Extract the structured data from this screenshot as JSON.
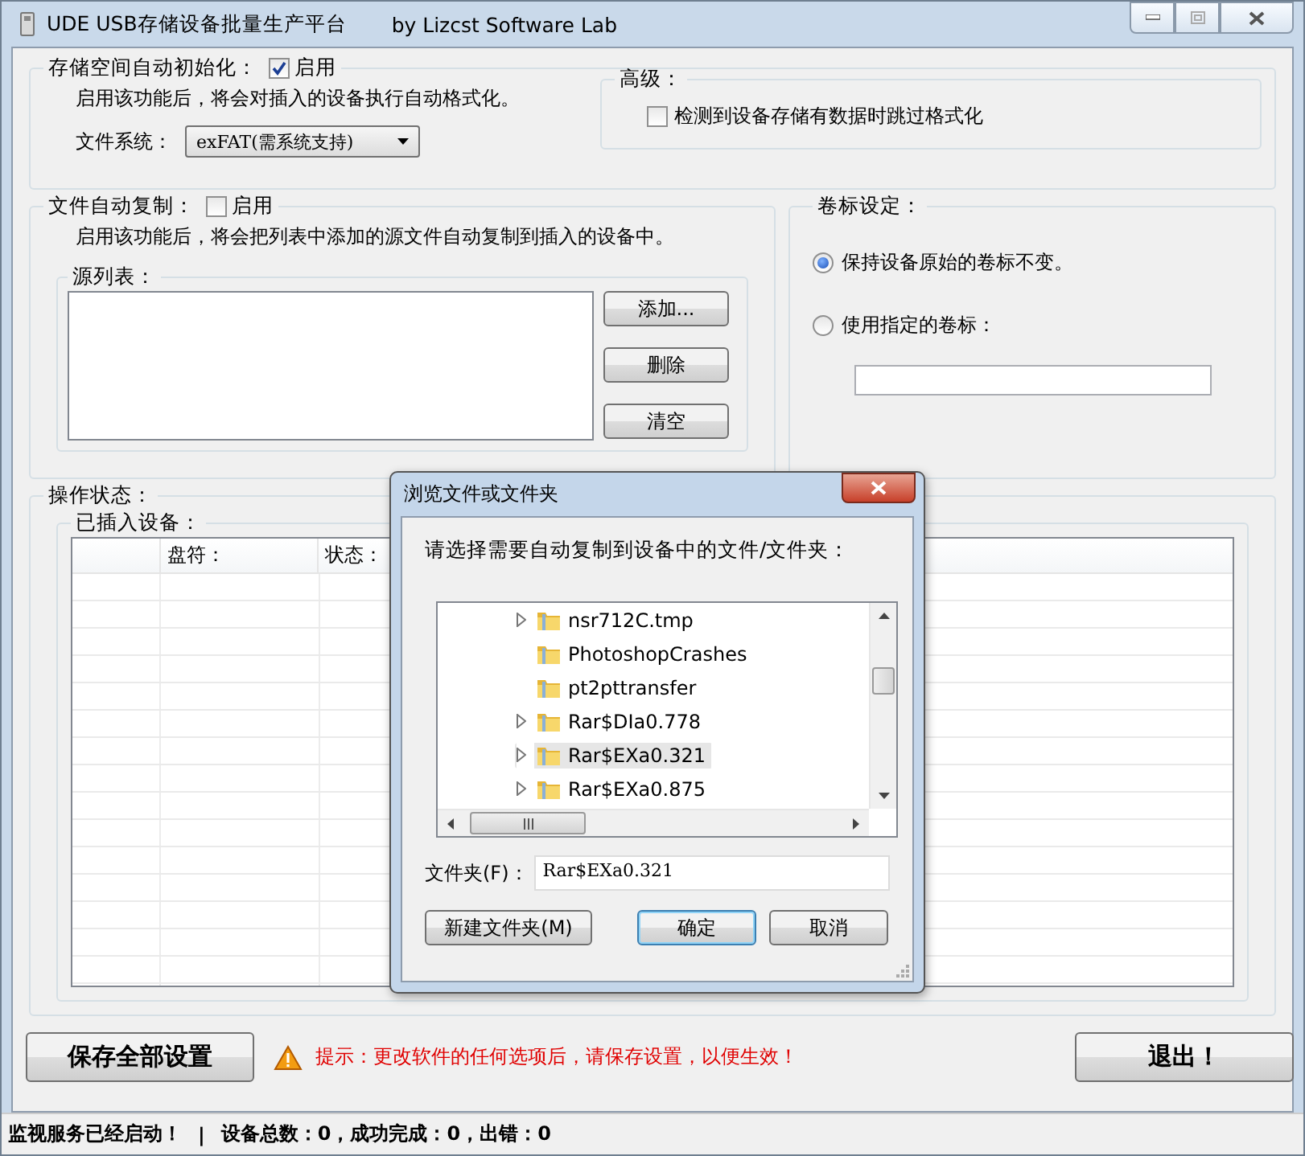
{
  "window": {
    "title": "UDE USB存储设备批量生产平台",
    "subtitle": "by Lizcst Software Lab"
  },
  "auto_format": {
    "label": "存储空间自动初始化：",
    "enable_label": "启用",
    "checked": true,
    "description": "启用该功能后，将会对插入的设备执行自动格式化。",
    "fs_label": "文件系统：",
    "fs_value": "exFAT(需系统支持)",
    "advanced": {
      "label": "高级：",
      "skip_label": "检测到设备存储有数据时跳过格式化",
      "checked": false
    }
  },
  "auto_copy": {
    "label": "文件自动复制：",
    "enable_label": "启用",
    "checked": false,
    "description": "启用该功能后，将会把列表中添加的源文件自动复制到插入的设备中。",
    "source_label": "源列表：",
    "buttons": [
      "添加...",
      "删除",
      "清空"
    ]
  },
  "volume_label": {
    "label": "卷标设定：",
    "options": [
      {
        "label": "保持设备原始的卷标不变。",
        "selected": true
      },
      {
        "label": "使用指定的卷标：",
        "selected": false
      }
    ]
  },
  "status": {
    "label": "操作状态：",
    "devices_label": "已插入设备：",
    "columns": [
      "盘符：",
      "状态："
    ]
  },
  "dialog": {
    "title": "浏览文件或文件夹",
    "prompt": "请选择需要自动复制到设备中的文件/文件夹：",
    "tree": [
      {
        "label": "nsr712C.tmp",
        "expandable": true,
        "selected": false
      },
      {
        "label": "PhotoshopCrashes",
        "expandable": false,
        "selected": false
      },
      {
        "label": "pt2pttransfer",
        "expandable": false,
        "selected": false
      },
      {
        "label": "Rar$DIa0.778",
        "expandable": true,
        "selected": false
      },
      {
        "label": "Rar$EXa0.321",
        "expandable": true,
        "selected": true
      },
      {
        "label": "Rar$EXa0.875",
        "expandable": true,
        "selected": false
      }
    ],
    "folder_label": "文件夹(F)：",
    "folder_value": "Rar$EXa0.321",
    "buttons": [
      {
        "label": "新建文件夹(M)",
        "default": false
      },
      {
        "label": "确定",
        "default": true
      },
      {
        "label": "取消",
        "default": false
      }
    ]
  },
  "footer": {
    "save": "保存全部设置",
    "hint": "提示：更改软件的任何选项后，请保存设置，以便生效！",
    "exit": "退出！"
  },
  "status_bar": [
    "监视服务已经启动！",
    "|",
    "设备总数：0，成功完成：0，出错：0"
  ]
}
